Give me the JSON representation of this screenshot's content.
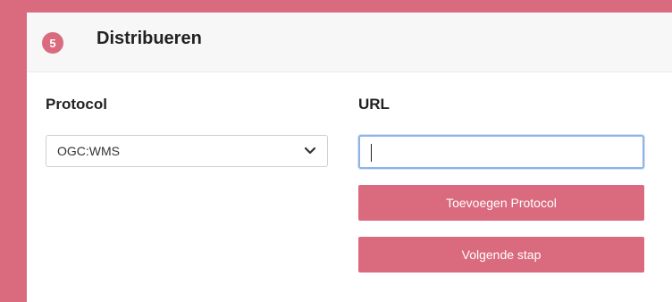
{
  "card": {
    "step_number": "5",
    "title": "Distribueren"
  },
  "form": {
    "protocol_label": "Protocol",
    "protocol_selected": "OGC:WMS",
    "url_label": "URL",
    "url_value": ""
  },
  "buttons": {
    "add_protocol": "Toevoegen Protocol",
    "next_step": "Volgende stap"
  },
  "colors": {
    "accent": "#da6a7e",
    "header_bg": "#f7f7f7",
    "focus_border": "#8fb3e6"
  },
  "icons": {
    "step_badge": "numbered-circle",
    "select_arrow": "chevron-down-icon"
  }
}
